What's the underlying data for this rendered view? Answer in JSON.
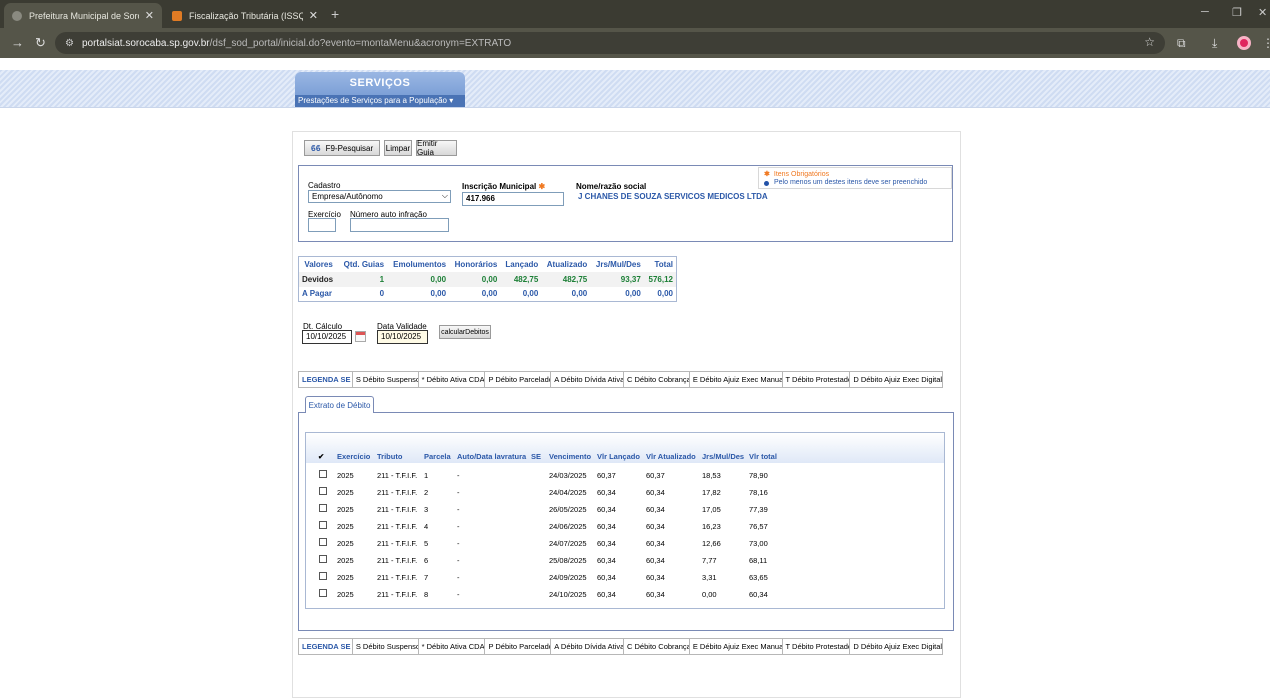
{
  "browser": {
    "tabs": [
      {
        "title": "Prefeitura Municipal de Sorocaba",
        "active": true
      },
      {
        "title": "Fiscalização Tributária (ISSQN e",
        "active": false
      }
    ],
    "url_host": "portalsiat.sorocaba.sp.gov.br",
    "url_path": "/dsf_sod_portal/inicial.do?evento=montaMenu&acronym=EXTRATO"
  },
  "header": {
    "title": "SERVIÇOS",
    "subtitle": "Prestações de Serviços para a População ▾"
  },
  "toolbar": {
    "search": "F9-Pesquisar",
    "clear": "Limpar",
    "emit": "Emitir Guia"
  },
  "form": {
    "cadastro_label": "Cadastro",
    "cadastro_value": "Empresa/Autônomo",
    "inscricao_label": "Inscrição Municipal",
    "inscricao_value": "417.966",
    "nome_label": "Nome/razão social",
    "nome_value": "J CHANES DE SOUZA SERVICOS MEDICOS LTDA",
    "exercicio_label": "Exercício",
    "exercicio_value": "",
    "auto_label": "Número auto infração",
    "auto_value": ""
  },
  "hint": {
    "required": "Itens Obrigatórios",
    "one_of": "Pelo menos um destes itens deve ser preenchido"
  },
  "summary": {
    "headers": [
      "Valores",
      "Qtd. Guias",
      "Emolumentos",
      "Honorários",
      "Lançado",
      "Atualizado",
      "Jrs/Mul/Des",
      "Total"
    ],
    "rows": [
      [
        "Devidos",
        "1",
        "0,00",
        "0,00",
        "482,75",
        "482,75",
        "93,37",
        "576,12"
      ],
      [
        "A Pagar",
        "0",
        "0,00",
        "0,00",
        "0,00",
        "0,00",
        "0,00",
        "0,00"
      ]
    ]
  },
  "dates": {
    "calc_label": "Dt. Cálculo",
    "calc_value": "10/10/2025",
    "valid_label": "Data Validade",
    "valid_value": "10/10/2025",
    "calc_button": "calcularDebitos"
  },
  "legend": [
    "LEGENDA SE",
    "S Débito Suspenso",
    "* Débito Ativa CDA",
    "P Débito Parcelado",
    "A Débito Dívida Ativa",
    "C Débito Cobrança",
    "E Débito Ajuiz Exec Manual",
    "T Débito Protestado",
    "D Débito Ajuiz Exec Digital"
  ],
  "extrato": {
    "tab_label": "Extrato de Débito",
    "check_header": "✔",
    "headers": [
      "Exercício",
      "Tributo",
      "Parcela",
      "Auto/Data lavratura",
      "SE",
      "Vencimento",
      "Vlr Lançado",
      "Vlr Atualizado",
      "Jrs/Mul/Des",
      "Vlr total"
    ],
    "rows": [
      [
        "2025",
        "211 - T.F.I.F.",
        "1",
        "-",
        "",
        "24/03/2025",
        "60,37",
        "60,37",
        "18,53",
        "78,90"
      ],
      [
        "2025",
        "211 - T.F.I.F.",
        "2",
        "-",
        "",
        "24/04/2025",
        "60,34",
        "60,34",
        "17,82",
        "78,16"
      ],
      [
        "2025",
        "211 - T.F.I.F.",
        "3",
        "-",
        "",
        "26/05/2025",
        "60,34",
        "60,34",
        "17,05",
        "77,39"
      ],
      [
        "2025",
        "211 - T.F.I.F.",
        "4",
        "-",
        "",
        "24/06/2025",
        "60,34",
        "60,34",
        "16,23",
        "76,57"
      ],
      [
        "2025",
        "211 - T.F.I.F.",
        "5",
        "-",
        "",
        "24/07/2025",
        "60,34",
        "60,34",
        "12,66",
        "73,00"
      ],
      [
        "2025",
        "211 - T.F.I.F.",
        "6",
        "-",
        "",
        "25/08/2025",
        "60,34",
        "60,34",
        "7,77",
        "68,11"
      ],
      [
        "2025",
        "211 - T.F.I.F.",
        "7",
        "-",
        "",
        "24/09/2025",
        "60,34",
        "60,34",
        "3,31",
        "63,65"
      ],
      [
        "2025",
        "211 - T.F.I.F.",
        "8",
        "-",
        "",
        "24/10/2025",
        "60,34",
        "60,34",
        "0,00",
        "60,34"
      ]
    ]
  }
}
